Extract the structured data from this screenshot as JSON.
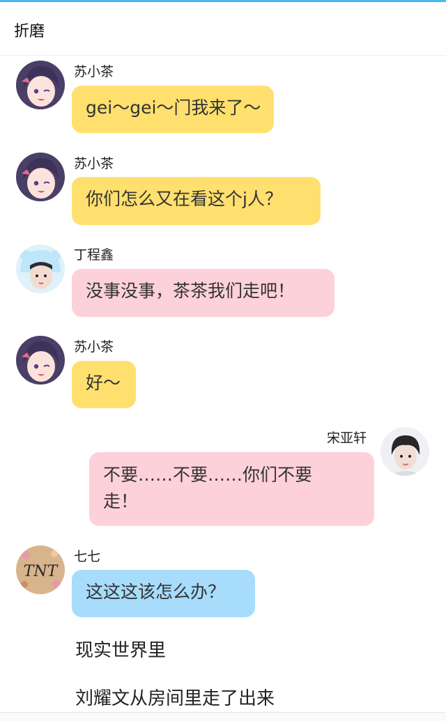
{
  "header": {
    "title": "折磨"
  },
  "messages": [
    {
      "name": "苏小茶",
      "text": "gei～gei～门我来了～"
    },
    {
      "name": "苏小茶",
      "text": "你们怎么又在看这个j人？"
    },
    {
      "name": "丁程鑫",
      "text": "没事没事，茶茶我们走吧！"
    },
    {
      "name": "苏小茶",
      "text": "好～"
    },
    {
      "name": "宋亚轩",
      "text": "不要……不要……你们不要走！"
    },
    {
      "name": "七七",
      "text": "这这这该怎么办？"
    }
  ],
  "narration": [
    "现实世界里",
    "刘耀文从房间里走了出来"
  ],
  "colors": {
    "accent": "#49b7f2",
    "yellow_bubble": "#ffe06e",
    "pink_bubble": "#fdd1da",
    "blue_bubble": "#a7dcfb"
  },
  "avatars": {
    "anime_girl": "purple-haired anime girl avatar",
    "boy_bear_hat": "boy in white bear hat avatar",
    "boy_portrait": "boy portrait avatar",
    "tnt_logo": "TNT logo avatar"
  }
}
